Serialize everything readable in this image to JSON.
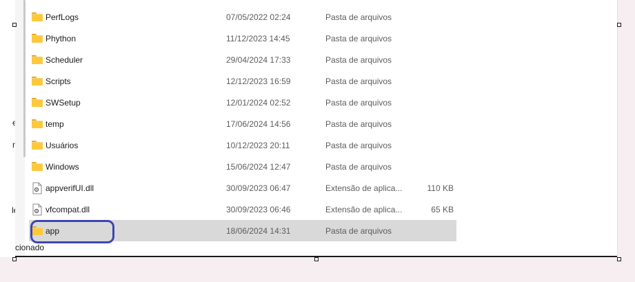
{
  "left_pane": {
    "fragments": [
      "e",
      "n",
      "le"
    ]
  },
  "files": [
    {
      "name": "PerfLogs",
      "date": "07/05/2022 02:24",
      "type": "Pasta de arquivos",
      "size": "",
      "icon": "folder-icon"
    },
    {
      "name": "Phython",
      "date": "11/12/2023 14:45",
      "type": "Pasta de arquivos",
      "size": "",
      "icon": "folder-icon"
    },
    {
      "name": "Scheduler",
      "date": "29/04/2024 17:33",
      "type": "Pasta de arquivos",
      "size": "",
      "icon": "folder-icon"
    },
    {
      "name": "Scripts",
      "date": "12/12/2023 16:59",
      "type": "Pasta de arquivos",
      "size": "",
      "icon": "folder-icon"
    },
    {
      "name": "SWSetup",
      "date": "12/01/2024 02:52",
      "type": "Pasta de arquivos",
      "size": "",
      "icon": "folder-icon"
    },
    {
      "name": "temp",
      "date": "17/06/2024 14:56",
      "type": "Pasta de arquivos",
      "size": "",
      "icon": "folder-icon"
    },
    {
      "name": "Usuários",
      "date": "10/12/2023 20:11",
      "type": "Pasta de arquivos",
      "size": "",
      "icon": "folder-icon"
    },
    {
      "name": "Windows",
      "date": "15/06/2024 12:47",
      "type": "Pasta de arquivos",
      "size": "",
      "icon": "folder-icon"
    },
    {
      "name": "appverifUI.dll",
      "date": "30/09/2023 06:47",
      "type": "Extensão de aplica...",
      "size": "110 KB",
      "icon": "dll-file-icon"
    },
    {
      "name": "vfcompat.dll",
      "date": "30/09/2023 06:46",
      "type": "Extensão de aplica...",
      "size": "65 KB",
      "icon": "dll-file-icon"
    },
    {
      "name": "app",
      "date": "18/06/2024 14:31",
      "type": "Pasta de arquivos",
      "size": "",
      "icon": "folder-icon",
      "selected": true
    }
  ],
  "status_bar": {
    "text": "cionado"
  },
  "colors": {
    "selection": "#d9d9d9",
    "annotation_oval": "#3b46b5",
    "folder": "#fcc93d",
    "background": "#f7eef2"
  }
}
